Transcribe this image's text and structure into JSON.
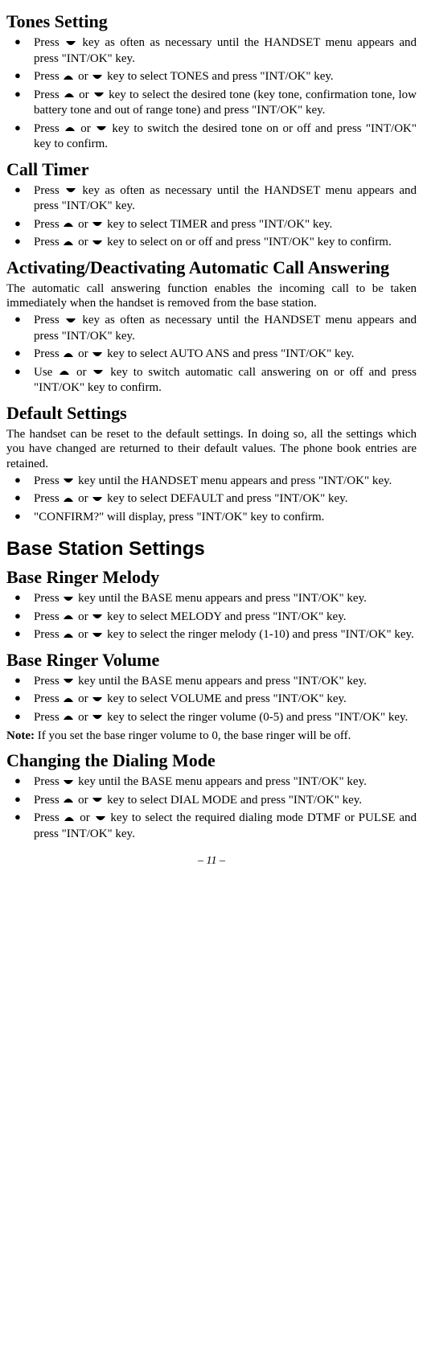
{
  "icons": {
    "up": "▲",
    "down": "▼",
    "bullet": "●"
  },
  "sections": {
    "tones": {
      "title": "Tones Setting",
      "items": [
        {
          "prefix": "Press ",
          "icon1": "down",
          "mid": " key as often as necessary until the HANDSET menu appears and press \"INT/OK\" key."
        },
        {
          "prefix": "Press ",
          "icon1": "up",
          "middle": " or ",
          "icon2": "down",
          "mid": " key to select TONES and press \"INT/OK\" key."
        },
        {
          "prefix": "Press ",
          "icon1": "up",
          "middle": " or ",
          "icon2": "down",
          "mid": " key to select the desired tone (key tone, confirmation tone, low battery tone and out of range tone) and press \"INT/OK\" key."
        },
        {
          "prefix": "Press ",
          "icon1": "up",
          "middle": " or ",
          "icon2": "down",
          "mid": " key to switch the desired tone on or off and press \"INT/OK\" key to confirm."
        }
      ]
    },
    "calltimer": {
      "title": "Call Timer",
      "items": [
        {
          "prefix": "Press ",
          "icon1": "down",
          "mid": " key as often as necessary until the HANDSET menu appears and press \"INT/OK\" key."
        },
        {
          "prefix": "Press ",
          "icon1": "up",
          "middle": " or ",
          "icon2": "down",
          "mid": " key to select TIMER and press \"INT/OK\" key."
        },
        {
          "prefix": "Press ",
          "icon1": "up",
          "middle": " or ",
          "icon2": "down",
          "mid": " key to select on or off and press \"INT/OK\" key to confirm."
        }
      ]
    },
    "autoans": {
      "title": "Activating/Deactivating Automatic Call Answering",
      "body": "The automatic call answering function enables the incoming call to be taken immediately when the handset is removed from the base station.",
      "items": [
        {
          "prefix": "Press ",
          "icon1": "down",
          "mid": " key as often as necessary until the HANDSET menu appears and press \"INT/OK\" key."
        },
        {
          "prefix": "Press ",
          "icon1": "up",
          "middle": " or ",
          "icon2": "down",
          "mid": " key to select AUTO ANS and press \"INT/OK\" key."
        },
        {
          "prefix": "Use ",
          "icon1": "up",
          "middle": " or ",
          "icon2": "down",
          "mid": " key to switch automatic call answering on or off and press \"INT/OK\" key to confirm."
        }
      ]
    },
    "default": {
      "title": "Default Settings",
      "body": "The handset can be reset to the default settings. In doing so, all the settings which you have changed are returned to their default values. The phone book entries are retained.",
      "items": [
        {
          "prefix": "Press ",
          "icon1": "down",
          "mid": " key until the HANDSET menu appears and press \"INT/OK\" key."
        },
        {
          "prefix": "Press ",
          "icon1": "up",
          "middle": " or ",
          "icon2": "down",
          "mid": " key to select DEFAULT and press \"INT/OK\" key."
        },
        {
          "prefix": "\"CONFIRM?\" will display, press \"INT/OK\" key to confirm."
        }
      ]
    },
    "basemajor": {
      "title": "Base Station Settings"
    },
    "basemelody": {
      "title": "Base Ringer Melody",
      "items": [
        {
          "prefix": "Press ",
          "icon1": "down",
          "mid": " key until the BASE menu appears and press \"INT/OK\" key."
        },
        {
          "prefix": "Press ",
          "icon1": "up",
          "middle": " or ",
          "icon2": "down",
          "mid": " key to select MELODY and press \"INT/OK\" key."
        },
        {
          "prefix": "Press ",
          "icon1": "up",
          "middle": " or ",
          "icon2": "down",
          "mid": " key to select the ringer melody (1-10) and press \"INT/OK\" key."
        }
      ]
    },
    "basevolume": {
      "title": "Base Ringer Volume",
      "items": [
        {
          "prefix": "Press ",
          "icon1": "down",
          "mid": " key until the BASE menu appears and press \"INT/OK\" key."
        },
        {
          "prefix": "Press ",
          "icon1": "up",
          "middle": " or ",
          "icon2": "down",
          "mid": " key to select VOLUME and press \"INT/OK\" key."
        },
        {
          "prefix": "Press ",
          "icon1": "up",
          "middle": " or ",
          "icon2": "down",
          "mid": " key to select the ringer volume (0-5) and press \"INT/OK\" key."
        }
      ],
      "note_label": "Note:",
      "note": " If you set the base ringer volume to 0, the base ringer will be off."
    },
    "dialmode": {
      "title": "Changing the Dialing Mode",
      "items": [
        {
          "prefix": "Press ",
          "icon1": "down",
          "mid": " key until the BASE menu appears and press \"INT/OK\" key."
        },
        {
          "prefix": "Press ",
          "icon1": "up",
          "middle": " or ",
          "icon2": "down",
          "mid": " key to select DIAL MODE and press \"INT/OK\" key."
        },
        {
          "prefix": "Press ",
          "icon1": "up",
          "middle": " or ",
          "icon2": "down",
          "mid": " key to select the required dialing mode DTMF or PULSE and press \"INT/OK\" key."
        }
      ]
    }
  },
  "footer": "– 11 –"
}
